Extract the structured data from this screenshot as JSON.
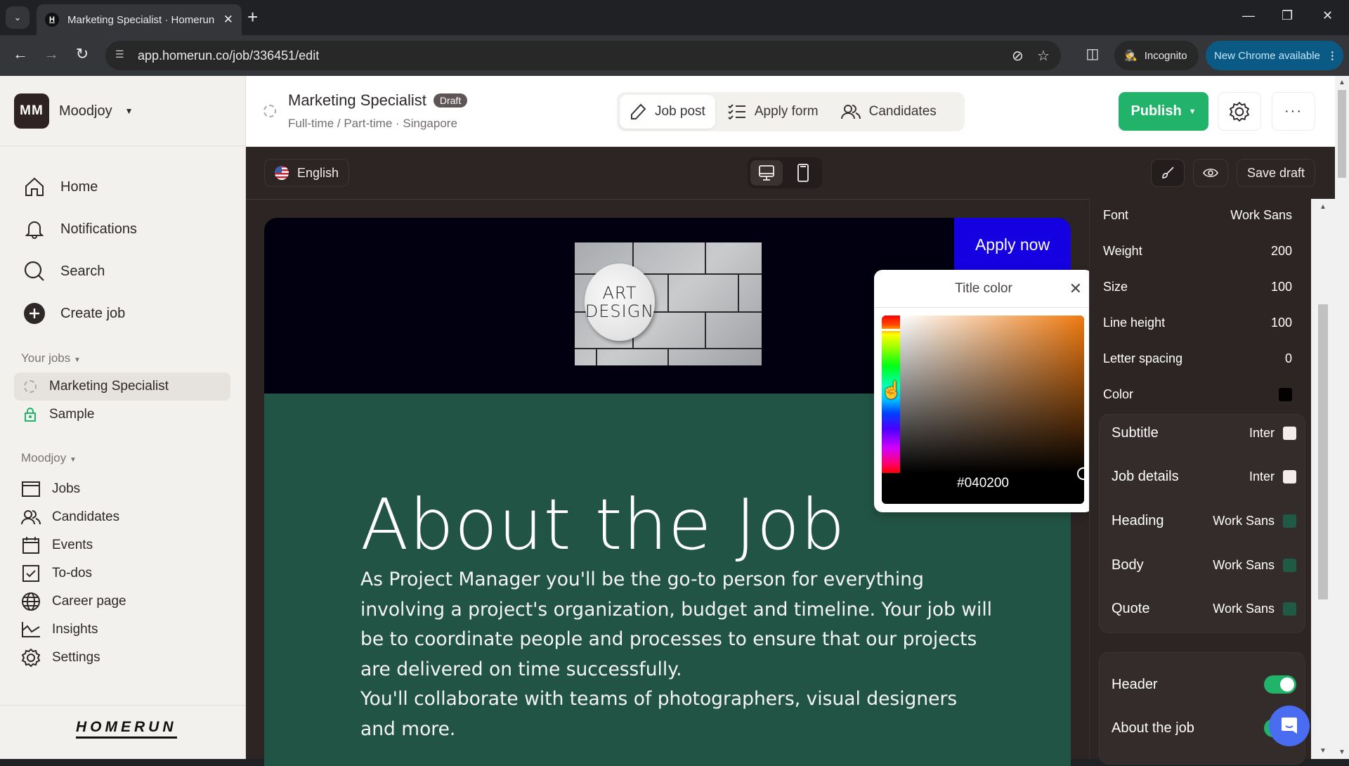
{
  "browser": {
    "tab_title": "Marketing Specialist · Homerun",
    "favicon_letter": "H",
    "url": "app.homerun.co/job/336451/edit",
    "incognito_label": "Incognito",
    "update_label": "New Chrome available"
  },
  "sidebar": {
    "org_initials": "MM",
    "org_name": "Moodjoy",
    "main_nav": [
      {
        "label": "Home",
        "icon": "home-icon"
      },
      {
        "label": "Notifications",
        "icon": "bell-icon"
      },
      {
        "label": "Search",
        "icon": "search-icon"
      },
      {
        "label": "Create job",
        "icon": "plus-circle-icon"
      }
    ],
    "your_jobs_label": "Your jobs",
    "jobs": [
      {
        "label": "Marketing Specialist",
        "status": "draft",
        "active": true
      },
      {
        "label": "Sample",
        "status": "locked",
        "active": false
      }
    ],
    "org_section_label": "Moodjoy",
    "org_nav": [
      {
        "label": "Jobs",
        "icon": "jobs-icon"
      },
      {
        "label": "Candidates",
        "icon": "candidates-icon"
      },
      {
        "label": "Events",
        "icon": "calendar-icon"
      },
      {
        "label": "To-dos",
        "icon": "checkbox-icon"
      },
      {
        "label": "Career page",
        "icon": "globe-icon"
      },
      {
        "label": "Insights",
        "icon": "chart-icon"
      },
      {
        "label": "Settings",
        "icon": "gear-icon"
      }
    ],
    "logo_text": "HOMERUN"
  },
  "header": {
    "job_title": "Marketing Specialist",
    "status_badge": "Draft",
    "subtitle": "Full-time / Part-time · Singapore",
    "tabs": [
      {
        "label": "Job post",
        "active": true
      },
      {
        "label": "Apply form",
        "active": false
      },
      {
        "label": "Candidates",
        "active": false
      }
    ],
    "publish_label": "Publish"
  },
  "editor": {
    "language": "English",
    "device_modes": [
      "desktop",
      "mobile"
    ],
    "active_device": "desktop",
    "save_draft_label": "Save draft",
    "preview": {
      "apply_button": "Apply now",
      "hero_image_text": [
        "ART",
        "DESIGN"
      ],
      "section_title": "About the Job",
      "body_paragraphs": [
        "As Project Manager you'll be the go-to person for everything involving a project's organization, budget and timeline. Your job will be to coordinate people and processes to ensure that our projects are delivered on time successfully.",
        "You'll collaborate with teams of photographers, visual designers and more."
      ]
    },
    "color_picker": {
      "title": "Title color",
      "hex_value": "#040200"
    }
  },
  "style_panel": {
    "typography": [
      {
        "label": "Font",
        "value": "Work Sans"
      },
      {
        "label": "Weight",
        "value": "200"
      },
      {
        "label": "Size",
        "value": "100"
      },
      {
        "label": "Line height",
        "value": "100"
      },
      {
        "label": "Letter spacing",
        "value": "0"
      },
      {
        "label": "Color",
        "value": "",
        "swatch": "#040200"
      }
    ],
    "fonts": [
      {
        "label": "Subtitle",
        "font": "Inter",
        "swatch": "#f4ecec"
      },
      {
        "label": "Job details",
        "font": "Inter",
        "swatch": "#f4ecec"
      },
      {
        "label": "Heading",
        "font": "Work Sans",
        "swatch": "#1f5a47"
      },
      {
        "label": "Body",
        "font": "Work Sans",
        "swatch": "#1f5a47"
      },
      {
        "label": "Quote",
        "font": "Work Sans",
        "swatch": "#1f5a47"
      }
    ],
    "sections": [
      {
        "label": "Header",
        "enabled": true
      },
      {
        "label": "About the job",
        "enabled": true
      }
    ]
  },
  "colors": {
    "brand_green": "#21b369",
    "apply_blue": "#1400e0",
    "preview_bg": "#225445",
    "hero_bg": "#020010",
    "editor_bg": "#2d2424"
  }
}
